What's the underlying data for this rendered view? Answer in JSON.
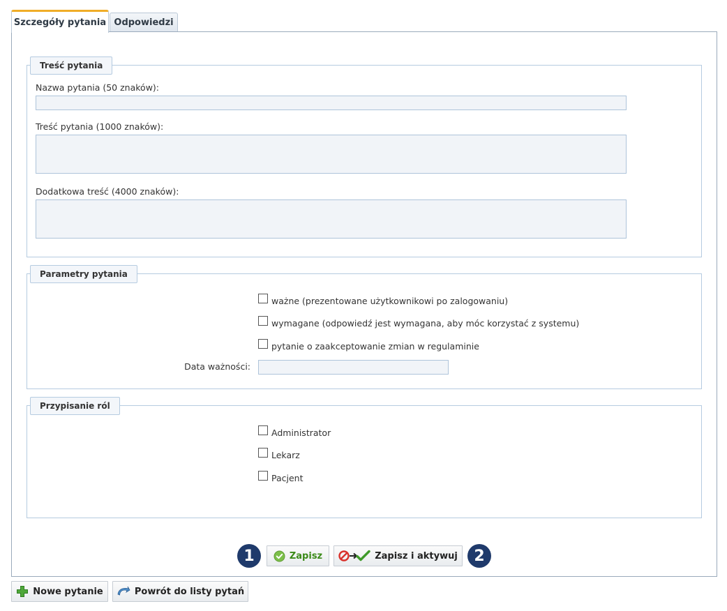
{
  "tabs": [
    {
      "label": "Szczegóły pytania",
      "active": true
    },
    {
      "label": "Odpowiedzi",
      "active": false
    }
  ],
  "content_section": {
    "legend": "Treść pytania",
    "fields": [
      {
        "label": "Nazwa pytania (50 znaków):",
        "value": ""
      },
      {
        "label": "Treść pytania (1000 znaków):",
        "value": ""
      },
      {
        "label": "Dodatkowa treść (4000 znaków):",
        "value": ""
      }
    ]
  },
  "params_section": {
    "legend": "Parametry pytania",
    "checkboxes": [
      {
        "label": "ważne (prezentowane użytkownikowi po zalogowaniu)",
        "checked": false
      },
      {
        "label": "wymagane (odpowiedź jest wymagana, aby móc korzystać z systemu)",
        "checked": false
      },
      {
        "label": "pytanie o zaakceptowanie zmian w regulaminie",
        "checked": false
      }
    ],
    "date_label": "Data ważności:",
    "date_value": ""
  },
  "roles_section": {
    "legend": "Przypisanie ról",
    "roles": [
      {
        "label": "Administrator",
        "checked": false
      },
      {
        "label": "Lekarz",
        "checked": false
      },
      {
        "label": "Pacjent",
        "checked": false
      }
    ]
  },
  "actions": {
    "badge_1": "1",
    "badge_2": "2",
    "save_label": "Zapisz",
    "save_activate_label": "Zapisz i aktywuj",
    "save_icon": "check-circle-icon",
    "save_activate_icon": "block-arrow-check-icon"
  },
  "footer": {
    "new_question_label": "Nowe pytanie",
    "new_question_icon": "green-plus-icon",
    "back_label": "Powrót do listy pytań",
    "back_icon": "back-arrow-icon"
  },
  "colors": {
    "tab_accent": "#f0ad28",
    "badge_bg": "#1f3a6b",
    "save_text": "#3b8a18",
    "input_bg": "#f1f4f8"
  }
}
